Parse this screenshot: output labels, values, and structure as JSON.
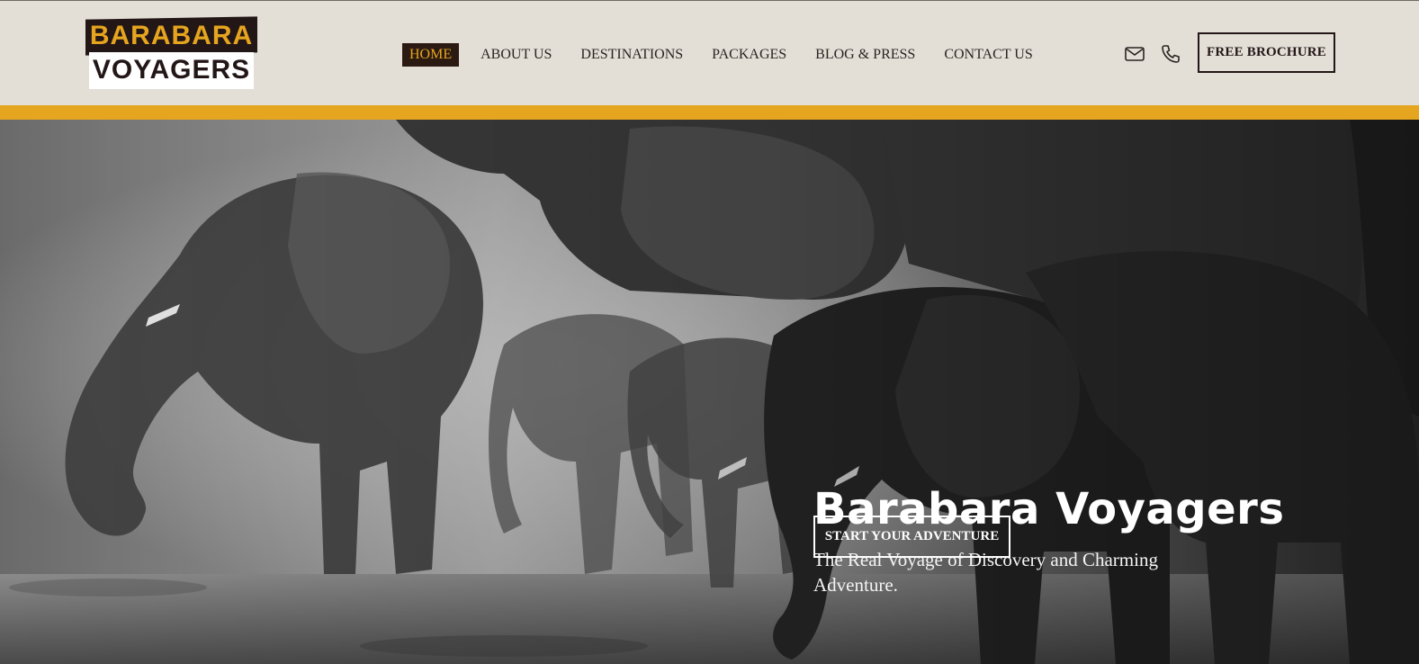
{
  "logo": {
    "line1": "BARABARA",
    "line2": "VOYAGERS"
  },
  "nav": {
    "items": [
      {
        "label": "HOME",
        "active": true
      },
      {
        "label": "ABOUT US",
        "active": false
      },
      {
        "label": "DESTINATIONS",
        "active": false
      },
      {
        "label": "PACKAGES",
        "active": false
      },
      {
        "label": "BLOG & PRESS",
        "active": false
      },
      {
        "label": "CONTACT US",
        "active": false
      }
    ]
  },
  "header_icons": [
    "mail-icon",
    "phone-icon"
  ],
  "header": {
    "cta_label": "FREE BROCHURE"
  },
  "hero": {
    "title": "Barabara Voyagers",
    "subtitle": "The Real Voyage of Discovery and Charming Adventure.",
    "cta_label": "START YOUR ADVENTURE",
    "image_subject": "elephants-drinking-at-waterhole"
  },
  "colors": {
    "header_bg": "#e3dfd7",
    "accent": "#e6a51f",
    "dark_brown": "#231616",
    "text": "#2a2420"
  }
}
